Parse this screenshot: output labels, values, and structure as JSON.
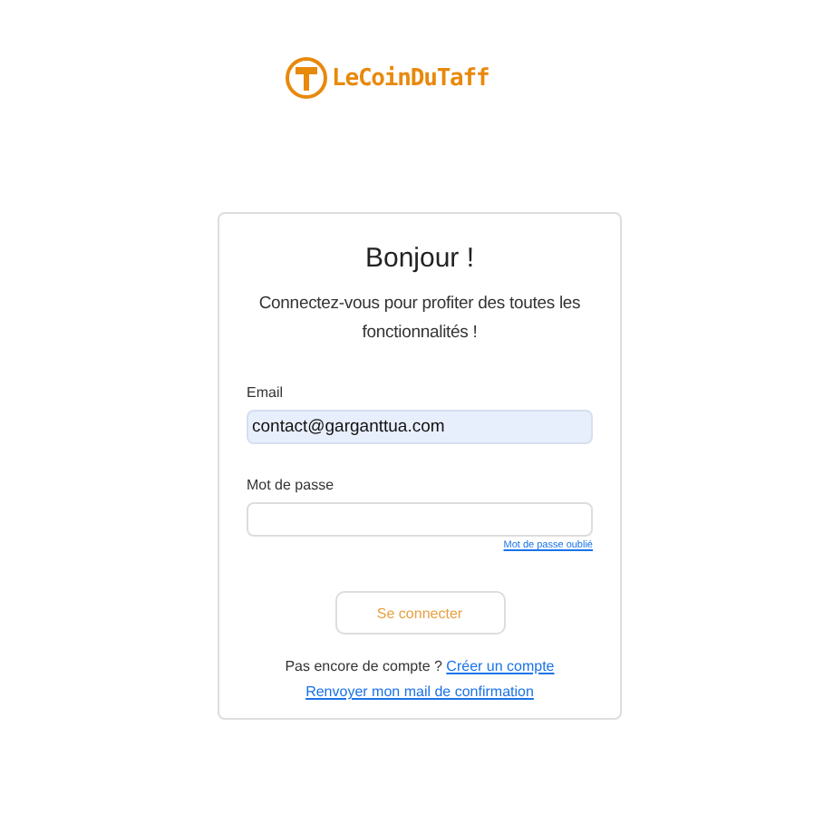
{
  "logo": {
    "text": "LeCoinDuTaff"
  },
  "card": {
    "title": "Bonjour !",
    "subtitle": "Connectez-vous pour profiter des toutes les fonctionnalités !",
    "email": {
      "label": "Email",
      "value": "contact@garganttua.com"
    },
    "password": {
      "label": "Mot de passe"
    },
    "forgot_link": "Mot de passe oublié",
    "submit_button": "Se connecter",
    "signup_prompt": "Pas encore de compte ?",
    "signup_link": "Créer un compte",
    "resend_link": "Renvoyer mon mail de confirmation"
  }
}
